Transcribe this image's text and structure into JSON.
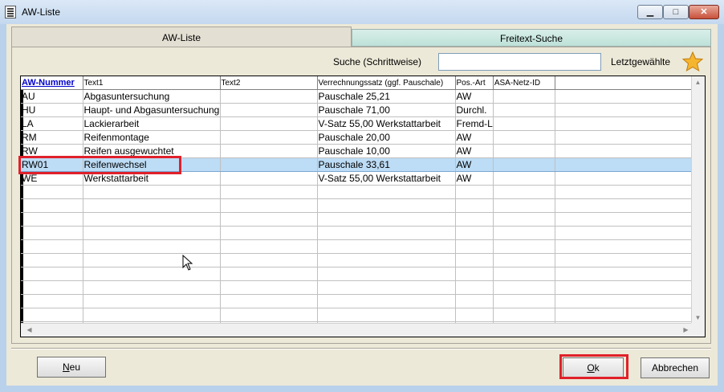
{
  "window": {
    "title": "AW-Liste",
    "minimize_glyph": "▁",
    "maximize_glyph": "□",
    "close_glyph": "✕"
  },
  "tabs": [
    {
      "label": "AW-Liste",
      "active": true
    },
    {
      "label": "Freitext-Suche",
      "active": false
    }
  ],
  "search": {
    "label": "Suche (Schrittweise)",
    "value": "",
    "recent_label": "Letztgewählte"
  },
  "grid": {
    "columns": [
      "AW-Nummer",
      "Text1",
      "Text2",
      "Verrechnungssatz (ggf. Pauschale)",
      "Pos.-Art",
      "ASA-Netz-ID"
    ],
    "sorted_column": "AW-Nummer",
    "rows": [
      {
        "nr": "AU",
        "text1": "Abgasuntersuchung",
        "text2": "",
        "satz": "Pauschale 25,21",
        "art": "AW",
        "asa": "",
        "selected": false
      },
      {
        "nr": "HU",
        "text1": "Haupt- und Abgasuntersuchung",
        "text2": "",
        "satz": "Pauschale 71,00",
        "art": "Durchl.",
        "asa": "",
        "selected": false
      },
      {
        "nr": "LA",
        "text1": "Lackierarbeit",
        "text2": "",
        "satz": "V-Satz 55,00 Werkstattarbeit",
        "art": "Fremd-L",
        "asa": "",
        "selected": false
      },
      {
        "nr": "RM",
        "text1": "Reifenmontage",
        "text2": "",
        "satz": "Pauschale 20,00",
        "art": "AW",
        "asa": "",
        "selected": false
      },
      {
        "nr": "RW",
        "text1": "Reifen ausgewuchtet",
        "text2": "",
        "satz": "Pauschale 10,00",
        "art": "AW",
        "asa": "",
        "selected": false
      },
      {
        "nr": "RW01",
        "text1": "Reifenwechsel",
        "text2": "",
        "satz": "Pauschale 33,61",
        "art": "AW",
        "asa": "",
        "selected": true
      },
      {
        "nr": "WE",
        "text1": "Werkstattarbeit",
        "text2": "",
        "satz": "V-Satz 55,00 Werkstattarbeit",
        "art": "AW",
        "asa": "",
        "selected": false
      }
    ],
    "empty_rows": 12
  },
  "buttons": {
    "new_mnemonic": "N",
    "new_rest": "eu",
    "ok_mnemonic": "O",
    "ok_rest": "k",
    "cancel": "Abbrechen"
  },
  "colors": {
    "selection": "#bddcf5",
    "annotation_red": "#e0202a",
    "sorted_header": "#0000cc"
  }
}
